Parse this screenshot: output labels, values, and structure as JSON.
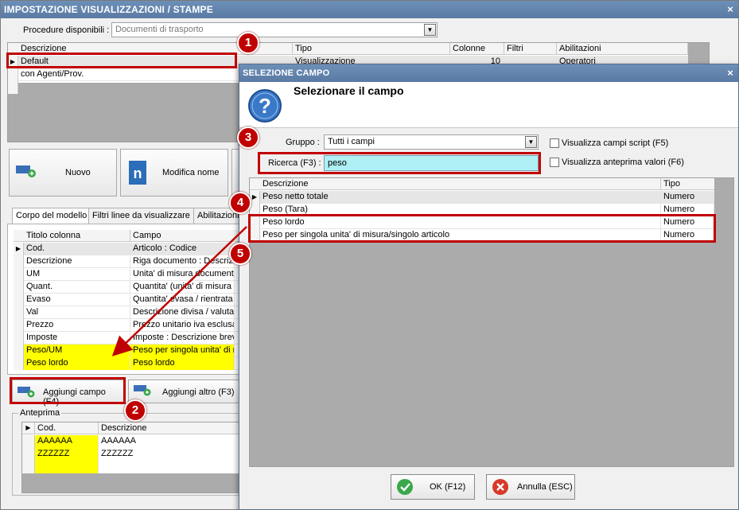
{
  "main": {
    "title": "IMPOSTAZIONE VISUALIZZAZIONI / STAMPE",
    "close": "×",
    "procedure_label": "Procedure disponibili :",
    "procedure_value": "Documenti di trasporto",
    "models": {
      "columns": [
        "Descrizione",
        "Tipo",
        "Colonne",
        "Filtri",
        "Abilitazioni"
      ],
      "rows": [
        {
          "descrizione": "Default",
          "tipo": "Visualizzazione",
          "colonne": "10",
          "filtri": "",
          "abilitazioni": "Operatori"
        },
        {
          "descrizione": "con Agenti/Prov.",
          "tipo": "",
          "colonne": "",
          "filtri": "",
          "abilitazioni": ""
        }
      ]
    },
    "btn_nuovo": "Nuovo",
    "btn_modifica": "Modifica nome",
    "tabs": [
      "Corpo del modello",
      "Filtri linee da visualizzare",
      "Abilitazioni"
    ],
    "body_grid": {
      "columns": [
        "Titolo colonna",
        "Campo"
      ],
      "rows": [
        {
          "titolo": "Cod.",
          "campo": "Articolo : Codice",
          "hl": false
        },
        {
          "titolo": "Descrizione",
          "campo": "Riga documento : Descrizione",
          "hl": false
        },
        {
          "titolo": "UM",
          "campo": "Unita' di misura documento",
          "hl": false
        },
        {
          "titolo": "Quant.",
          "campo": "Quantita' (unita' di misura documento)",
          "hl": false
        },
        {
          "titolo": "Evaso",
          "campo": "Quantita' evasa / rientrata",
          "hl": false
        },
        {
          "titolo": "Val",
          "campo": "Descrizione divisa / valuta",
          "hl": false
        },
        {
          "titolo": "Prezzo",
          "campo": "Prezzo unitario iva esclusa",
          "hl": false
        },
        {
          "titolo": "Imposte",
          "campo": "Imposte : Descrizione breve",
          "hl": false
        },
        {
          "titolo": "Peso/UM",
          "campo": "Peso per singola unita' di misura",
          "hl": true
        },
        {
          "titolo": "Peso lordo",
          "campo": "Peso lordo",
          "hl": true
        }
      ]
    },
    "btn_aggiungi_campo": "Aggiungi campo (F4)",
    "btn_aggiungi_altro": "Aggiungi altro (F3)",
    "anteprima_label": "Anteprima",
    "preview": {
      "columns": [
        "Cod.",
        "Descrizione"
      ],
      "rows": [
        {
          "cod": "AAAAAA",
          "descr": "AAAAAA"
        },
        {
          "cod": "ZZZZZZ",
          "descr": "ZZZZZZ"
        }
      ]
    }
  },
  "dialog": {
    "title": "SELEZIONE CAMPO",
    "close": "×",
    "heading": "Selezionare il campo",
    "gruppo_label": "Gruppo :",
    "gruppo_value": "Tutti i campi",
    "ricerca_label": "Ricerca (F3) :",
    "ricerca_value": "peso",
    "chk_script": "Visualizza campi script (F5)",
    "chk_anteprima": "Visualizza anteprima valori (F6)",
    "grid": {
      "columns": [
        "Descrizione",
        "Tipo"
      ],
      "rows": [
        {
          "descr": "Peso netto totale",
          "tipo": "Numero"
        },
        {
          "descr": "Peso (Tara)",
          "tipo": "Numero"
        },
        {
          "descr": "Peso lordo",
          "tipo": "Numero"
        },
        {
          "descr": "Peso per singola unita' di misura/singolo articolo",
          "tipo": "Numero"
        }
      ]
    },
    "ok_label": "OK (F12)",
    "cancel_label": "Annulla (ESC)"
  },
  "badges": [
    "1",
    "2",
    "3",
    "4",
    "5"
  ],
  "colors": {
    "title_bar": "#5a7aa3",
    "highlight": "#ffff00",
    "annotation": "#c00000",
    "search_bg": "#aef0f4"
  }
}
